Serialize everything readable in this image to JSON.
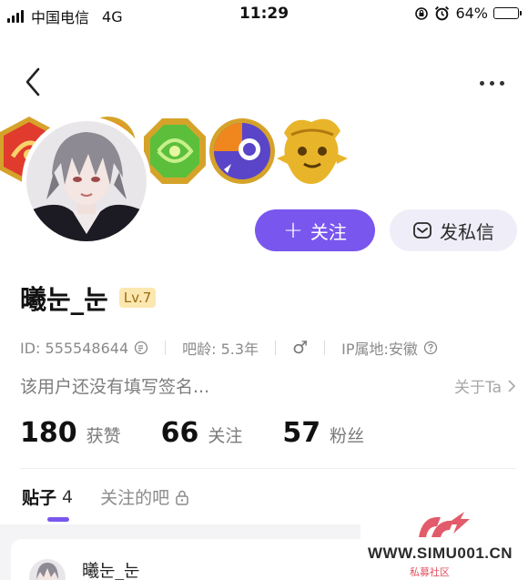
{
  "status_bar": {
    "carrier": "中国电信",
    "network": "4G",
    "time": "11:29",
    "battery_percent": "64%",
    "battery_level": 0.64
  },
  "nav": {
    "back_icon": "chevron-left-icon",
    "more_icon": "more-dots-icon"
  },
  "badges": [
    "medal-badge-1",
    "medal-badge-2",
    "medal-badge-3",
    "medal-badge-4",
    "medal-badge-5"
  ],
  "profile": {
    "username": "曦눈_눈",
    "level": "Lv.7",
    "id_text": "ID: 555548644",
    "tieba_age": "吧龄: 5.3年",
    "gender_symbol": "♂",
    "ip_location": "IP属地:安徽",
    "signature": "该用户还没有填写签名...",
    "about_link": "关于Ta"
  },
  "actions": {
    "follow_label": "关注",
    "message_label": "发私信"
  },
  "stats": [
    {
      "value": "180",
      "label": "获赞"
    },
    {
      "value": "66",
      "label": "关注"
    },
    {
      "value": "57",
      "label": "粉丝"
    }
  ],
  "tabs": {
    "posts_label": "贴子",
    "posts_count": "4",
    "followed_bars_label": "关注的吧"
  },
  "feed": {
    "post_author": "曦눈_눈"
  },
  "watermark": {
    "text": "WWW.SIMU001.CN",
    "sub": "私募社区"
  },
  "colors": {
    "accent": "#7957ee",
    "message_button_bg": "#efedf8",
    "level_badge_bg": "#fbe8b0"
  }
}
